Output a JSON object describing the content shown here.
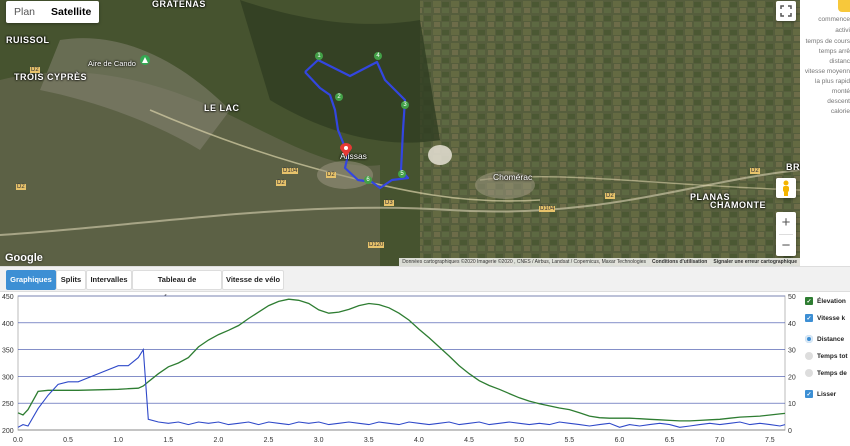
{
  "map": {
    "toggle": [
      "Plan",
      "Satellite"
    ],
    "selected": "Satellite",
    "place_labels": [
      "GRATENAS",
      "RUISSOL",
      "Aire de Cando",
      "TROIS CYPRÈS",
      "LE LAC",
      "Alissas",
      "Chomérac",
      "PLANAS",
      "CHAMONTE",
      "BRE"
    ],
    "road_labels": [
      "D2",
      "D2",
      "D104",
      "D2",
      "D2",
      "D3",
      "D120",
      "D104",
      "D2",
      "D2"
    ],
    "route_markers": [
      "1",
      "2",
      "3",
      "4",
      "5",
      "6"
    ],
    "google": "Google",
    "attribution": [
      "Données cartographiques ©2020 Imagerie ©2020 , CNES / Airbus, Landsat / Copernicus, Maxar Technologies",
      "Conditions d'utilisation",
      "Signaler une erreur cartographique"
    ],
    "zoom_in": "+",
    "zoom_out": "−",
    "colors": {
      "route": "#3346e0",
      "start": "#e53935",
      "end": "#43a047"
    }
  },
  "side_panel": [
    "commence",
    "activi",
    "temps de cours",
    "temps arrê",
    "distanc",
    "vitesse moyenn",
    "la plus rapid",
    "monté",
    "descent",
    "calorie"
  ],
  "tabs": [
    {
      "label": "Graphiques",
      "active": true
    },
    {
      "label": "Splits",
      "active": false
    },
    {
      "label": "Intervalles",
      "active": false
    },
    {
      "label": "Tableau de performances",
      "active": false
    },
    {
      "label": "Vitesse de vélo",
      "active": false
    }
  ],
  "legend": [
    {
      "label": "Élevation",
      "kind": "checkbox",
      "checked": true,
      "color": "#2e7d32"
    },
    {
      "label": "Vitesse  k",
      "kind": "checkbox",
      "checked": true,
      "color": "#3d8fd4"
    },
    {
      "label": "Distance",
      "kind": "radio",
      "checked": true
    },
    {
      "label": "Temps tot",
      "kind": "radio",
      "checked": false
    },
    {
      "label": "Temps de",
      "kind": "radio",
      "checked": false
    },
    {
      "label": "Lisser",
      "kind": "checkbox",
      "checked": true,
      "color": "#3d8fd4"
    }
  ],
  "chart_data": {
    "type": "line",
    "x": [
      0,
      0.05,
      0.1,
      0.2,
      0.3,
      0.4,
      0.5,
      0.6,
      0.8,
      1.0,
      1.1,
      1.2,
      1.25,
      1.3,
      1.4,
      1.5,
      1.6,
      1.7,
      1.8,
      1.9,
      2.0,
      2.1,
      2.2,
      2.3,
      2.4,
      2.5,
      2.6,
      2.7,
      2.8,
      2.9,
      3.0,
      3.1,
      3.2,
      3.3,
      3.4,
      3.5,
      3.6,
      3.7,
      3.8,
      3.9,
      4.0,
      4.1,
      4.2,
      4.3,
      4.4,
      4.5,
      4.6,
      4.7,
      4.8,
      4.9,
      5.0,
      5.1,
      5.2,
      5.3,
      5.4,
      5.5,
      5.6,
      5.7,
      5.8,
      5.9,
      6.0,
      6.1,
      6.2,
      6.3,
      6.4,
      6.5,
      6.6,
      6.7,
      6.8,
      6.9,
      7.0,
      7.1,
      7.2,
      7.3,
      7.4,
      7.5,
      7.6,
      7.65
    ],
    "series": [
      {
        "name": "Élevation",
        "axis": "left",
        "color": "#2e7d32",
        "values": [
          232,
          228,
          238,
          272,
          274,
          274,
          274,
          274,
          275,
          276,
          277,
          278,
          282,
          290,
          305,
          318,
          325,
          335,
          355,
          368,
          378,
          386,
          395,
          408,
          420,
          432,
          440,
          444,
          442,
          436,
          424,
          418,
          420,
          425,
          432,
          436,
          434,
          428,
          418,
          405,
          388,
          372,
          355,
          338,
          320,
          305,
          292,
          283,
          276,
          268,
          260,
          254,
          249,
          245,
          241,
          238,
          232,
          226,
          223,
          222,
          222,
          222,
          221,
          220,
          219,
          218,
          217,
          217,
          218,
          219,
          220,
          222,
          224,
          225,
          226,
          228,
          230,
          231
        ]
      },
      {
        "name": "Vitesse",
        "axis": "right",
        "color": "#3d8fd4",
        "values": [
          1,
          2,
          1.5,
          8,
          13,
          17,
          18,
          18,
          21,
          24,
          24,
          27,
          30,
          4,
          3,
          2.5,
          3,
          2,
          3,
          2.5,
          3,
          2,
          2.5,
          3,
          2,
          3,
          2.5,
          2,
          3,
          2.5,
          3,
          2,
          2.5,
          3,
          2.5,
          2,
          3,
          2.5,
          2,
          3,
          2.5,
          2,
          2.5,
          3,
          2,
          2.5,
          3,
          2,
          2.5,
          3,
          2.5,
          2,
          2.5,
          2,
          3,
          2.5,
          2,
          1.5,
          2,
          2.5,
          1,
          2,
          1.5,
          2,
          2.5,
          2,
          1,
          1.5,
          2,
          2.5,
          2,
          2.5,
          3,
          2,
          2.5,
          2,
          1.5,
          2
        ]
      }
    ],
    "xlim": [
      0,
      7.65
    ],
    "ylim_left": [
      200,
      450
    ],
    "ylim_right": [
      0,
      50
    ],
    "xticks": [
      "0.0",
      "0.5",
      "1.0",
      "1.5",
      "2.0",
      "2.5",
      "3.0",
      "3.5",
      "4.0",
      "4.5",
      "5.0",
      "5.5",
      "6.0",
      "6.5",
      "7.0",
      "7.5"
    ],
    "yticks_left": [
      "200",
      "250",
      "300",
      "350",
      "400",
      "450"
    ],
    "yticks_right": [
      "0",
      "10",
      "20",
      "30",
      "40",
      "50"
    ],
    "grid": true
  }
}
